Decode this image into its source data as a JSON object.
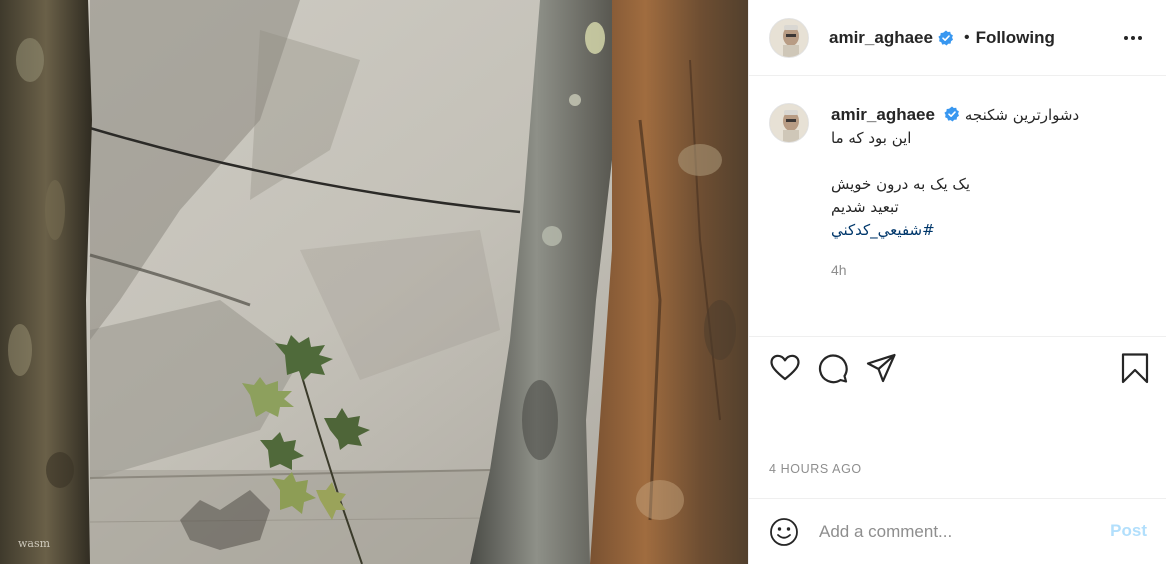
{
  "post": {
    "image_alt": "Tree trunks in front of a shaded wall with a young leafy branch",
    "signature": "wasm"
  },
  "header": {
    "username": "amir_aghaee",
    "separator": "•",
    "follow_status": "Following",
    "verified_icon": "verified-badge-icon",
    "more_icon": "more-options-icon"
  },
  "caption": {
    "username": "amir_aghaee",
    "line1": "دشوارترین شکنجه",
    "line2": "این بود که ما",
    "line3": "",
    "line4": "یک یک به درون خویش",
    "line5": "تبعید شدیم",
    "hashtag": "#شفیعي_کدکني",
    "time_ago": "4h"
  },
  "actions": {
    "like_icon": "heart-icon",
    "comment_icon": "comment-bubble-icon",
    "share_icon": "paper-plane-icon",
    "save_icon": "bookmark-icon"
  },
  "timestamp": "4 HOURS AGO",
  "comment_box": {
    "placeholder": "Add a comment...",
    "post_label": "Post",
    "emoji_icon": "smiley-icon"
  },
  "colors": {
    "link": "#00376b",
    "verified": "#3897f0",
    "post_disabled": "#b2dffc",
    "muted": "#8e8e8e"
  }
}
